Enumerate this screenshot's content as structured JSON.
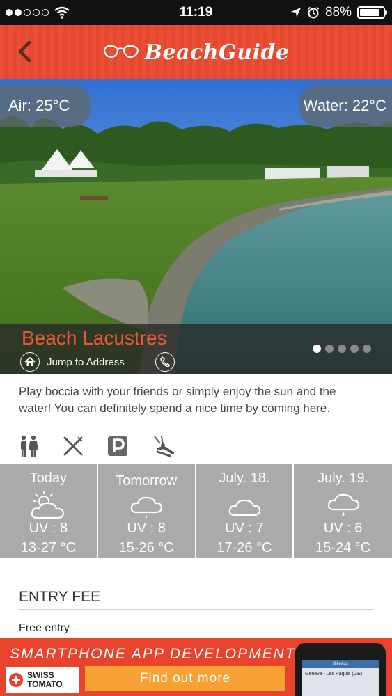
{
  "status_bar": {
    "time": "11:19",
    "battery": "88%",
    "battery_level": 0.88,
    "signal_dots_filled": 2
  },
  "header": {
    "logo_text": "BeachGuide",
    "back_icon": "chevron-left-icon"
  },
  "hero": {
    "air_temp": "Air: 25°C",
    "water_temp": "Water: 22°C",
    "beach_name": "Beach Lacustres",
    "jump_label": "Jump to Address",
    "pager_count": 5,
    "pager_active": 0
  },
  "description": "Play boccia with your friends or simply enjoy the sun and the water! You can definitely spend a nice time by coming here.",
  "amenities": [
    "restroom-icon",
    "restaurant-icon",
    "parking-icon",
    "playground-icon"
  ],
  "weather": [
    {
      "label": "Today",
      "icon": "sun-cloud-icon",
      "uv": "UV : 8",
      "temp": "13-27 °C"
    },
    {
      "label": "Tomorrow",
      "icon": "cloud-rain-icon",
      "uv": "UV : 8",
      "temp": "15-26 °C"
    },
    {
      "label": "July. 18.",
      "icon": "cloud-icon",
      "uv": "UV : 7",
      "temp": "17-26 °C"
    },
    {
      "label": "July. 19.",
      "icon": "cloud-rain-icon",
      "uv": "UV : 6",
      "temp": "15-24 °C"
    }
  ],
  "entry_fee": {
    "heading": "ENTRY FEE",
    "value": "Free entry"
  },
  "ad": {
    "headline": "SMARTPHONE APP DEVELOPMENT",
    "brand_line1": "SWISS",
    "brand_line2": "TOMATO",
    "cta": "Find out more",
    "phone_app_name": "BikeAxs",
    "phone_route": "Geneva - Les Pâquis (GE)"
  },
  "colors": {
    "header_red": "#ea4e35",
    "beach_name_orange": "#ee5a36",
    "weather_gray": "#aaaaaa",
    "ad_red": "#e8442d",
    "ad_cta_orange": "#f5a133"
  }
}
